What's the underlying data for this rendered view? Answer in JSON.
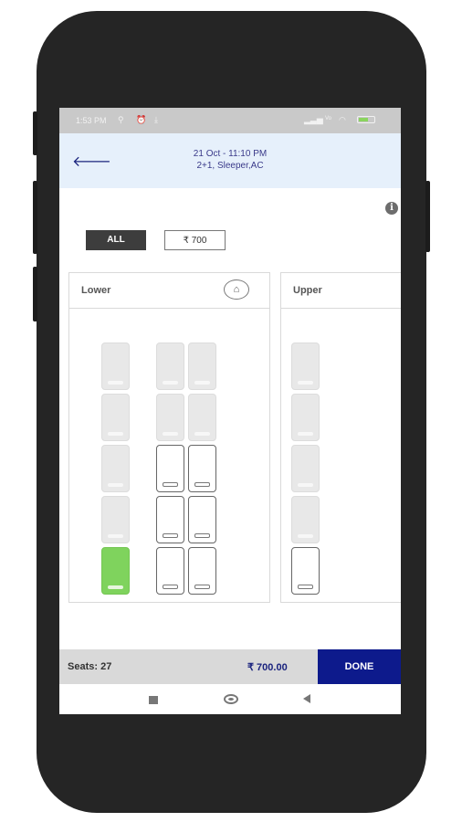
{
  "status_bar": {
    "time": "1:53 PM",
    "icons": [
      "usb-icon",
      "alarm-icon",
      "download-icon",
      "signal-icon",
      "volte-icon",
      "wifi-icon",
      "battery-icon"
    ]
  },
  "header": {
    "back_icon": "arrow-left-icon",
    "line1": "21 Oct - 11:10 PM",
    "line2": "2+1, Sleeper,AC"
  },
  "filters": {
    "all_label": "ALL",
    "price_label": "₹ 700"
  },
  "decks": {
    "lower": {
      "title": "Lower",
      "seat_states": [
        "booked",
        "booked",
        "booked",
        "booked",
        "booked",
        "booked",
        "booked",
        "available",
        "available",
        "booked",
        "available",
        "available",
        "selected",
        "available",
        "available"
      ]
    },
    "upper": {
      "title": "Upper",
      "seat_states": [
        "booked",
        "booked",
        "booked",
        "booked",
        "available"
      ]
    }
  },
  "footer": {
    "seats_label": "Seats: 27",
    "total_label": "₹  700.00",
    "done_label": "DONE"
  },
  "colors": {
    "selected": "#7fd35d",
    "done_bg": "#0d1a8c",
    "header_bg": "#e6f0fb"
  }
}
